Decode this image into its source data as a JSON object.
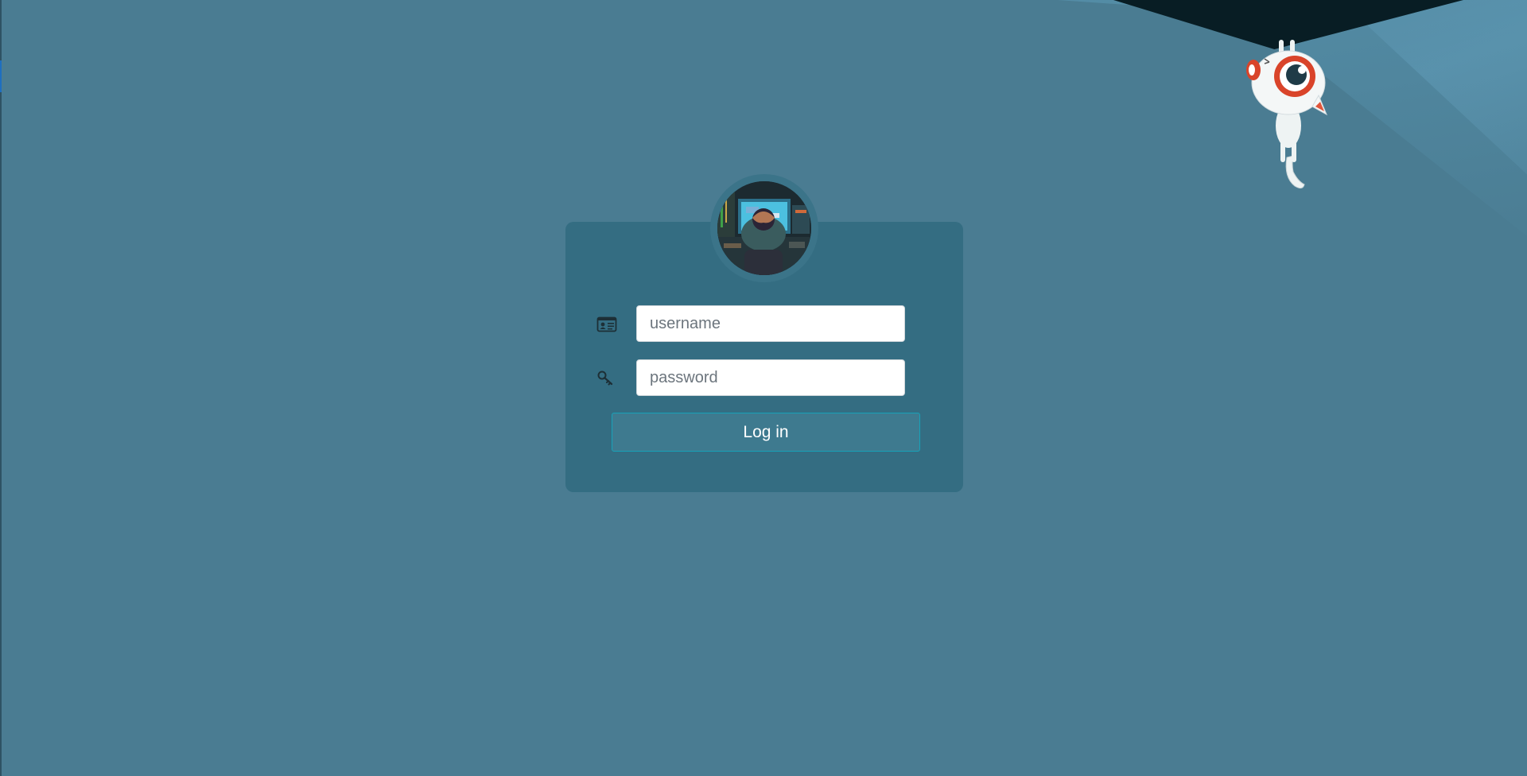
{
  "login": {
    "username_placeholder": "username",
    "password_placeholder": "password",
    "submit_label": "Log in"
  },
  "icons": {
    "username": "id-card-icon",
    "password": "key-icon"
  },
  "colors": {
    "background": "#4a7c92",
    "card": "#346d82",
    "button": "#3e7a8f",
    "button_border": "#17a2b8"
  }
}
